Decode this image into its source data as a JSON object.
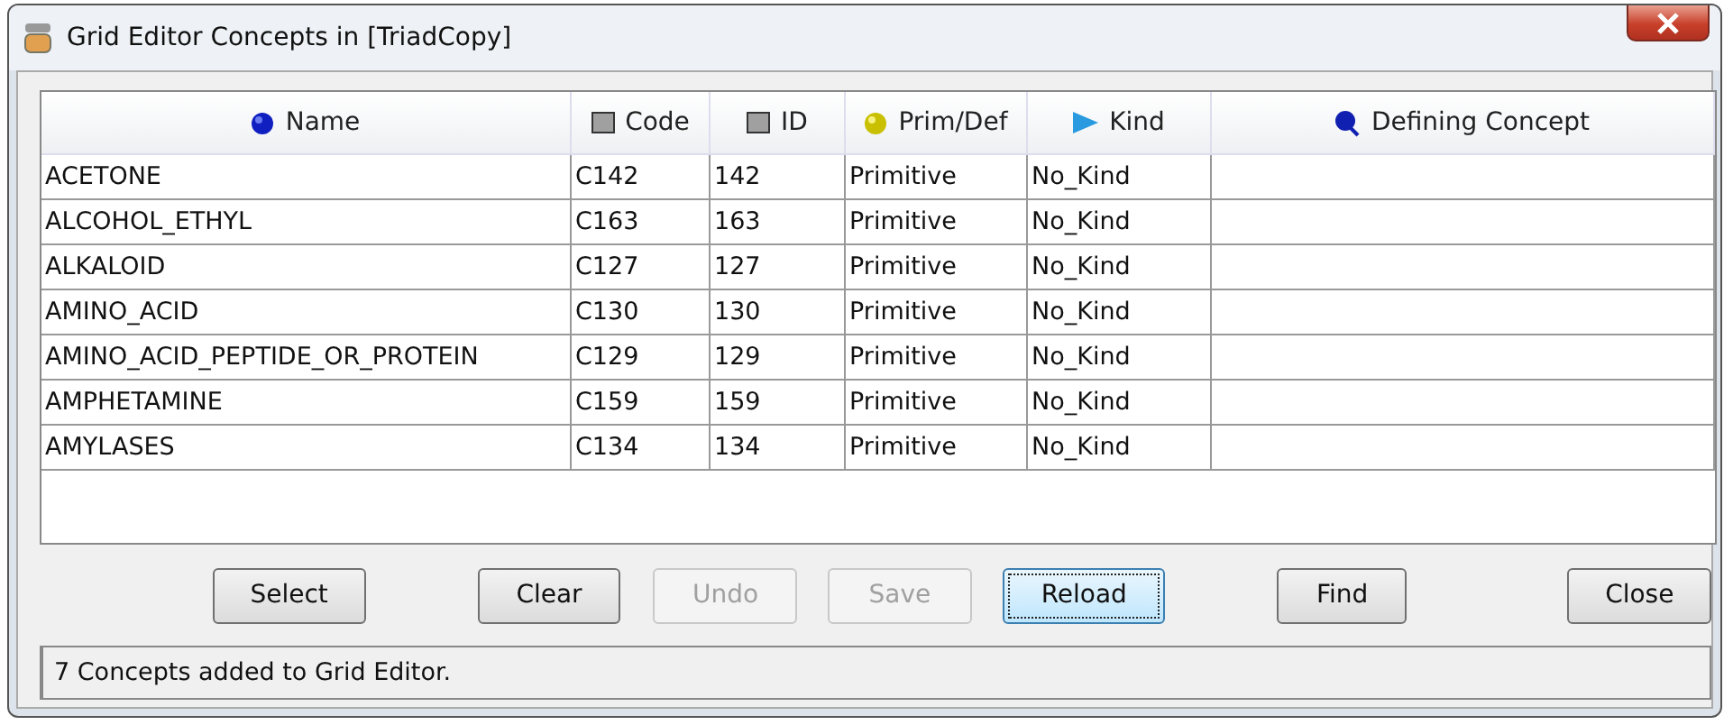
{
  "window": {
    "title": "Grid Editor Concepts in [TriadCopy]"
  },
  "table": {
    "columns": [
      {
        "label": "Name",
        "kind": "sphere"
      },
      {
        "label": "Code",
        "kind": "square"
      },
      {
        "label": "ID",
        "kind": "square"
      },
      {
        "label": "Prim/Def",
        "kind": "sphere"
      },
      {
        "label": "Kind",
        "kind": "triangle"
      },
      {
        "label": "Defining Concept",
        "kind": "magnifier"
      }
    ],
    "rows": [
      [
        "ACETONE",
        "C142",
        "142",
        "Primitive",
        "No_Kind",
        ""
      ],
      [
        "ALCOHOL_ETHYL",
        "C163",
        "163",
        "Primitive",
        "No_Kind",
        ""
      ],
      [
        "ALKALOID",
        "C127",
        "127",
        "Primitive",
        "No_Kind",
        ""
      ],
      [
        "AMINO_ACID",
        "C130",
        "130",
        "Primitive",
        "No_Kind",
        ""
      ],
      [
        "AMINO_ACID_PEPTIDE_OR_PROTEIN",
        "C129",
        "129",
        "Primitive",
        "No_Kind",
        ""
      ],
      [
        "AMPHETAMINE",
        "C159",
        "159",
        "Primitive",
        "No_Kind",
        ""
      ],
      [
        "AMYLASES",
        "C134",
        "134",
        "Primitive",
        "No_Kind",
        ""
      ]
    ]
  },
  "buttons": [
    {
      "label": "Select",
      "disabled": false,
      "focused": false
    },
    {
      "label": "Clear",
      "disabled": false,
      "focused": false
    },
    {
      "label": "Undo",
      "disabled": true,
      "focused": false
    },
    {
      "label": "Save",
      "disabled": true,
      "focused": false
    },
    {
      "label": "Reload",
      "disabled": false,
      "focused": true
    },
    {
      "label": "Find",
      "disabled": false,
      "focused": false
    },
    {
      "label": "Close",
      "disabled": false,
      "focused": false
    }
  ],
  "status_bar": "7 Concepts added to Grid Editor."
}
